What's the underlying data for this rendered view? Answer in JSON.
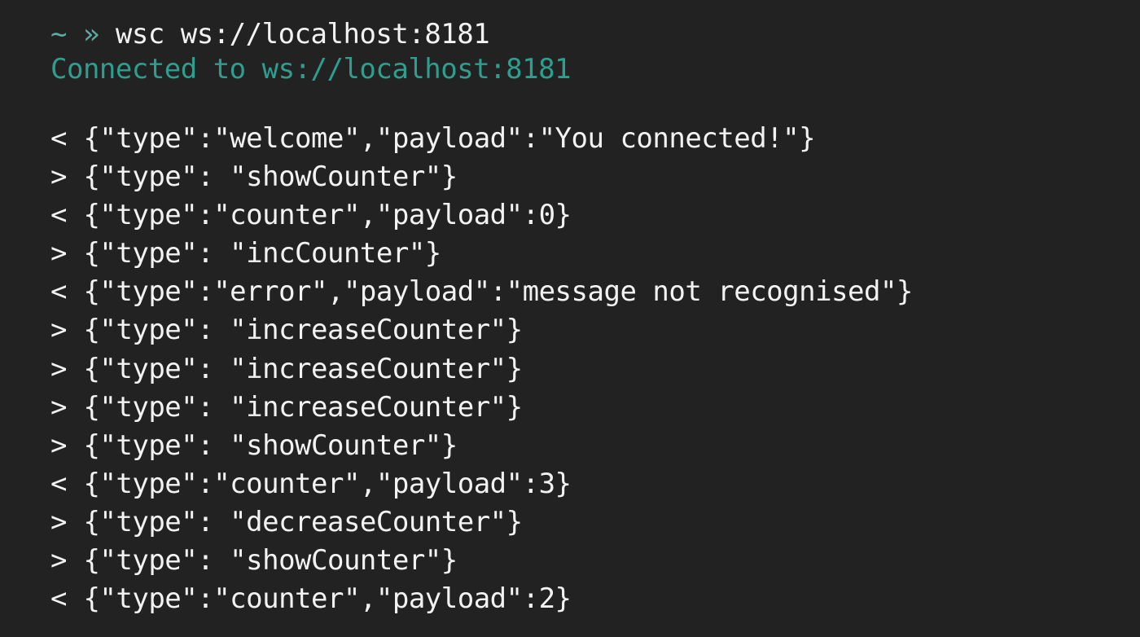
{
  "terminal": {
    "prompt": {
      "symbol": "~ »",
      "command": " wsc ws://localhost:8181"
    },
    "status": "Connected to ws://localhost:8181",
    "messages": [
      {
        "dir": "<",
        "text": " {\"type\":\"welcome\",\"payload\":\"You connected!\"}"
      },
      {
        "dir": ">",
        "text": " {\"type\": \"showCounter\"}"
      },
      {
        "dir": "<",
        "text": " {\"type\":\"counter\",\"payload\":0}"
      },
      {
        "dir": ">",
        "text": " {\"type\": \"incCounter\"}"
      },
      {
        "dir": "<",
        "text": " {\"type\":\"error\",\"payload\":\"message not recognised\"}"
      },
      {
        "dir": ">",
        "text": " {\"type\": \"increaseCounter\"}"
      },
      {
        "dir": ">",
        "text": " {\"type\": \"increaseCounter\"}"
      },
      {
        "dir": ">",
        "text": " {\"type\": \"increaseCounter\"}"
      },
      {
        "dir": ">",
        "text": " {\"type\": \"showCounter\"}"
      },
      {
        "dir": "<",
        "text": " {\"type\":\"counter\",\"payload\":3}"
      },
      {
        "dir": ">",
        "text": " {\"type\": \"decreaseCounter\"}"
      },
      {
        "dir": ">",
        "text": " {\"type\": \"showCounter\"}"
      },
      {
        "dir": "<",
        "text": " {\"type\":\"counter\",\"payload\":2}"
      }
    ]
  }
}
